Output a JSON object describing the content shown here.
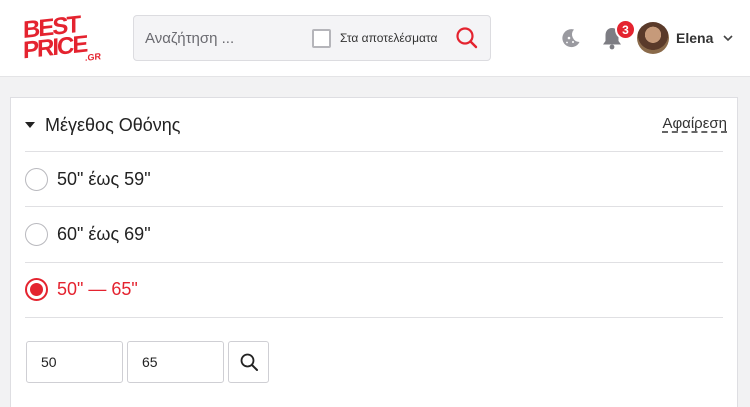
{
  "brand": {
    "logo_line1": "BEST",
    "logo_line2": "PRICE",
    "logo_suffix": ".GR",
    "accent_color": "#e4232f"
  },
  "search": {
    "placeholder": "Αναζήτηση ...",
    "value": "",
    "in_results_label": "Στα αποτελέσματα",
    "in_results_checked": false,
    "submit_icon": "search-icon"
  },
  "header": {
    "theme_icon": "moon-stars-icon",
    "notifications_icon": "bell-icon",
    "notifications_count": "3",
    "user": {
      "name": "Elena",
      "menu_icon": "chevron-down-icon"
    }
  },
  "facet": {
    "title": "Μέγεθος Οθόνης",
    "remove_label": "Αφαίρεση",
    "options": [
      {
        "label": "50\" έως 59\"",
        "selected": false
      },
      {
        "label": "60\" έως 69\"",
        "selected": false
      },
      {
        "label": "50\" — 65\"",
        "selected": true
      }
    ],
    "range": {
      "min": "50",
      "max": "65",
      "submit_icon": "search-icon"
    }
  }
}
